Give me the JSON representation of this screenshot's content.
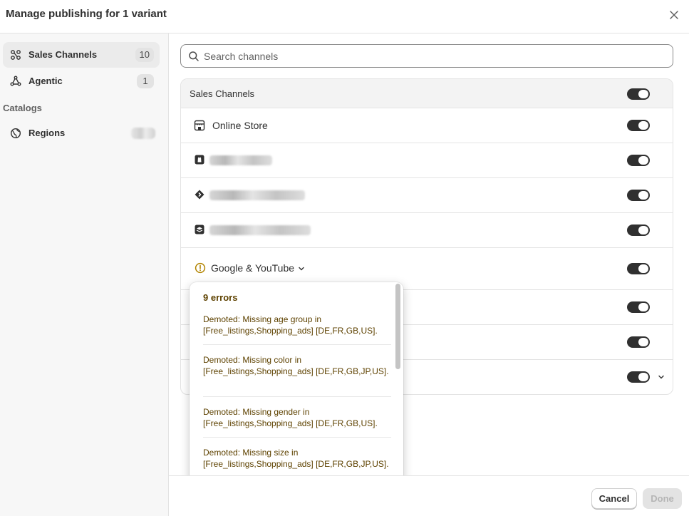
{
  "modal": {
    "title": "Manage publishing for 1 variant"
  },
  "sidebar": {
    "items": [
      {
        "label": "Sales Channels",
        "count": "10",
        "icon": "channels-icon",
        "active": true
      },
      {
        "label": "Agentic",
        "count": "1",
        "icon": "agentic-icon",
        "active": false
      }
    ],
    "section_label": "Catalogs",
    "catalog_items": [
      {
        "label": "Regions",
        "icon": "globe-icon"
      }
    ]
  },
  "search": {
    "placeholder": "Search channels",
    "value": ""
  },
  "channels": {
    "header_label": "Sales Channels",
    "rows": [
      {
        "name": "Online Store",
        "icon": "store-icon",
        "on": true
      },
      {
        "name": "",
        "icon": "shop-bag-icon",
        "on": true,
        "blurred": true
      },
      {
        "name": "",
        "icon": "diamond-arrow-icon",
        "on": true,
        "blurred": true
      },
      {
        "name": "",
        "icon": "stack-icon",
        "on": true,
        "blurred": true
      },
      {
        "name": "Google & YouTube",
        "icon": "warning-icon",
        "on": true,
        "expandable": true
      },
      {
        "name": "",
        "on": true
      },
      {
        "name": "",
        "on": true
      },
      {
        "name": "",
        "on": true,
        "expandable": true
      }
    ]
  },
  "errors_popover": {
    "title": "9 errors",
    "items": [
      "Demoted: Missing age group in [Free_listings,Shopping_ads] [DE,FR,GB,US].",
      "Demoted: Missing color in [Free_listings,Shopping_ads] [DE,FR,GB,JP,US].",
      "Demoted: Missing gender in [Free_listings,Shopping_ads] [DE,FR,GB,US].",
      "Demoted: Missing size in [Free_listings,Shopping_ads] [DE,FR,GB,JP,US]."
    ]
  },
  "footer": {
    "cancel_label": "Cancel",
    "done_label": "Done"
  },
  "colors": {
    "accent": "#303030",
    "warning_text": "#5e4200",
    "warning_icon": "#b28400"
  }
}
